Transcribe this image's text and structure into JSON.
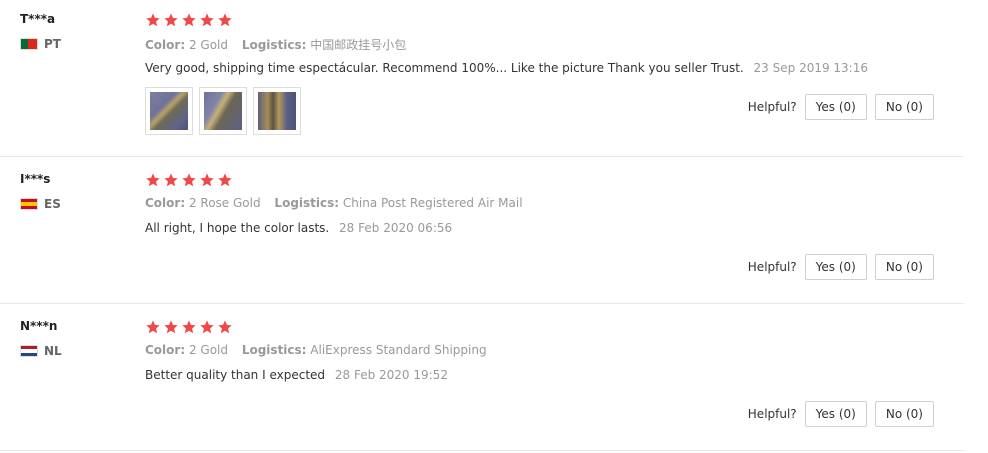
{
  "reviews": [
    {
      "user": "T***a",
      "country": "PT",
      "flag": "portugal-flag",
      "rating": 5,
      "color_label": "Color:",
      "color_value": "2 Gold",
      "logistics_label": "Logistics:",
      "logistics_value": "中国邮政挂号小包",
      "text": "Very good, shipping time espectácular. Recommend 100%... Like the picture Thank you seller Trust.",
      "date": "23 Sep 2019 13:16",
      "helpful_label": "Helpful?",
      "yes_label": "Yes (0)",
      "no_label": "No (0)",
      "photos": 3
    },
    {
      "user": "I***s",
      "country": "ES",
      "flag": "spain-flag",
      "rating": 5,
      "color_label": "Color:",
      "color_value": "2 Rose Gold",
      "logistics_label": "Logistics:",
      "logistics_value": "China Post Registered Air Mail",
      "text": "All right, I hope the color lasts.",
      "date": "28 Feb 2020 06:56",
      "helpful_label": "Helpful?",
      "yes_label": "Yes (0)",
      "no_label": "No (0)",
      "photos": 0
    },
    {
      "user": "N***n",
      "country": "NL",
      "flag": "netherlands-flag",
      "rating": 5,
      "color_label": "Color:",
      "color_value": "2 Gold",
      "logistics_label": "Logistics:",
      "logistics_value": "AliExpress Standard Shipping",
      "text": "Better quality than I expected",
      "date": "28 Feb 2020 19:52",
      "helpful_label": "Helpful?",
      "yes_label": "Yes (0)",
      "no_label": "No (0)",
      "photos": 0
    }
  ],
  "colors": {
    "star": "#f04848",
    "border": "#e8e8e8"
  }
}
